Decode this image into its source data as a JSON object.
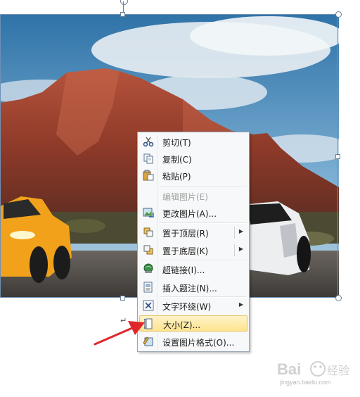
{
  "menu": {
    "items": [
      {
        "label": "剪切(T)",
        "icon": "scissors-icon",
        "enabled": true
      },
      {
        "label": "复制(C)",
        "icon": "copy-icon",
        "enabled": true
      },
      {
        "label": "粘贴(P)",
        "icon": "paste-icon",
        "enabled": true
      },
      {
        "label": "编辑图片(E)",
        "icon": "",
        "enabled": false
      },
      {
        "label": "更改图片(A)...",
        "icon": "change-picture-icon",
        "enabled": true
      },
      {
        "label": "置于顶层(R)",
        "icon": "bring-to-front-icon",
        "enabled": true,
        "submenu": true
      },
      {
        "label": "置于底层(K)",
        "icon": "send-to-back-icon",
        "enabled": true,
        "submenu": true
      },
      {
        "label": "超链接(I)...",
        "icon": "hyperlink-icon",
        "enabled": true
      },
      {
        "label": "插入题注(N)...",
        "icon": "insert-caption-icon",
        "enabled": true
      },
      {
        "label": "文字环绕(W)",
        "icon": "text-wrap-icon",
        "enabled": true,
        "submenu": true
      },
      {
        "label": "大小(Z)...",
        "icon": "size-icon",
        "enabled": true,
        "highlighted": true
      },
      {
        "label": "设置图片格式(O)...",
        "icon": "format-picture-icon",
        "enabled": true
      }
    ]
  },
  "watermark": {
    "text": "jingyan.baidu.com"
  },
  "colors": {
    "highlight": "#fde38e",
    "arrow": "#e0262b",
    "selection": "#6f8fb5"
  }
}
